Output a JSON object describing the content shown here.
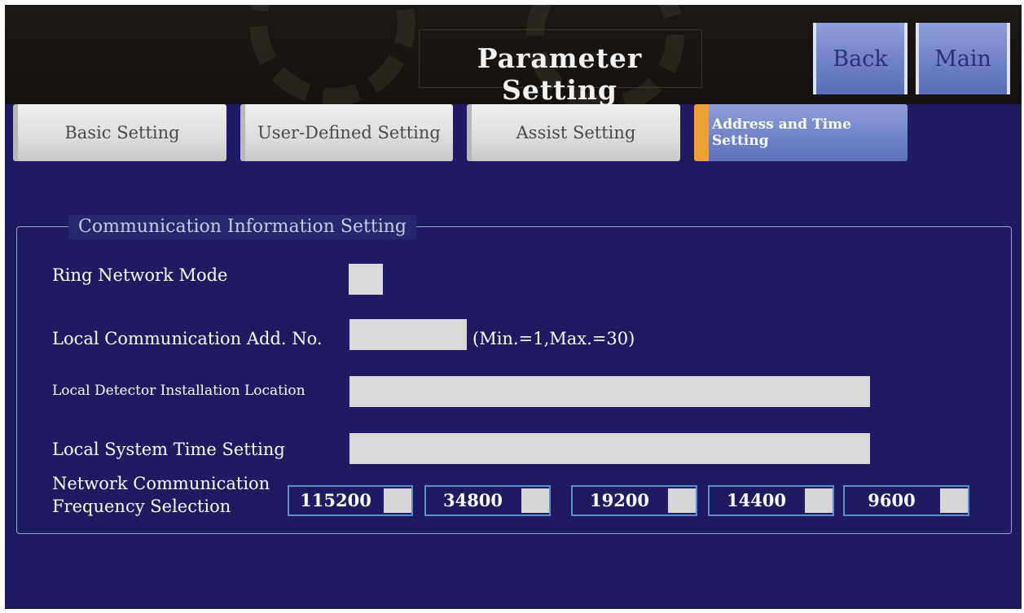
{
  "header": {
    "title": "Parameter Setting",
    "back_label": "Back",
    "main_label": "Main"
  },
  "tabs": [
    {
      "label": "Basic Setting",
      "active": false
    },
    {
      "label": "User-Defined Setting",
      "active": false
    },
    {
      "label": "Assist Setting",
      "active": false
    },
    {
      "label": "Address and Time Setting",
      "active": true
    }
  ],
  "section": {
    "legend": "Communication Information Setting",
    "ring_network_mode": {
      "label": "Ring Network Mode",
      "checked": false
    },
    "local_address": {
      "label": "Local Communication Add. No.",
      "value": "",
      "range_hint": "(Min.=1,Max.=30)"
    },
    "installation_location": {
      "label": "Local Detector Installation Location",
      "value": ""
    },
    "system_time": {
      "label": "Local System Time Setting",
      "value": ""
    },
    "frequency": {
      "label_line1": "Network Communication",
      "label_line2": "Frequency Selection",
      "options": [
        {
          "value": "115200",
          "selected": false
        },
        {
          "value": "34800",
          "selected": false
        },
        {
          "value": "19200",
          "selected": false
        },
        {
          "value": "14400",
          "selected": false
        },
        {
          "value": "9600",
          "selected": false
        }
      ]
    }
  },
  "colors": {
    "background": "#1f1a62",
    "header": "#15110f",
    "active_tab": "#6f82c8",
    "active_tab_marker": "#f0a030",
    "inactive_tab": "#dcdcdc",
    "input_box": "#d9d9d9",
    "frequency_border": "#5a8fd0"
  }
}
